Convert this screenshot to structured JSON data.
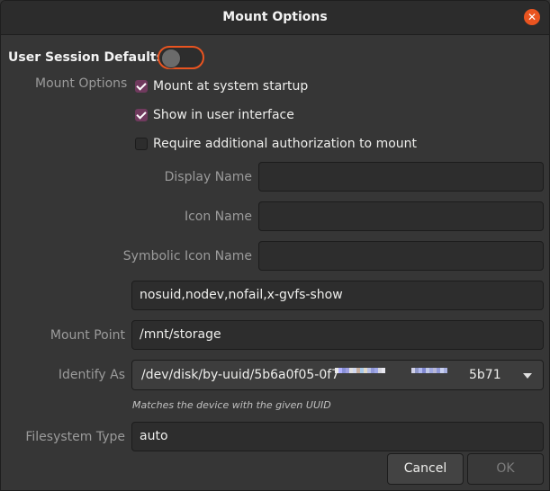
{
  "window": {
    "title": "Mount Options",
    "close_glyph": "✕"
  },
  "user_session": {
    "label": "User Session Defaults",
    "enabled": false
  },
  "mount_options": {
    "label": "Mount Options",
    "checks": [
      {
        "label": "Mount at system startup",
        "checked": true
      },
      {
        "label": "Show in user interface",
        "checked": true
      },
      {
        "label": "Require additional authorization to mount",
        "checked": false
      }
    ],
    "display_name": {
      "label": "Display Name",
      "value": ""
    },
    "icon_name": {
      "label": "Icon Name",
      "value": ""
    },
    "symbolic_icon_name": {
      "label": "Symbolic Icon Name",
      "value": ""
    },
    "options_value": "nosuid,nodev,nofail,x-gvfs-show"
  },
  "mount_point": {
    "label": "Mount Point",
    "value": "/mnt/storage"
  },
  "identify_as": {
    "label": "Identify As",
    "value_prefix": "/dev/disk/by-uuid/5b6a0f05-0f7",
    "value_suffix": "5b71",
    "hint": "Matches the device with the given UUID"
  },
  "filesystem_type": {
    "label": "Filesystem Type",
    "value": "auto"
  },
  "buttons": {
    "cancel": "Cancel",
    "ok": "OK"
  },
  "colors": {
    "accent": "#e95420",
    "checkbox_on": "#703a5e",
    "background": "#363636"
  }
}
